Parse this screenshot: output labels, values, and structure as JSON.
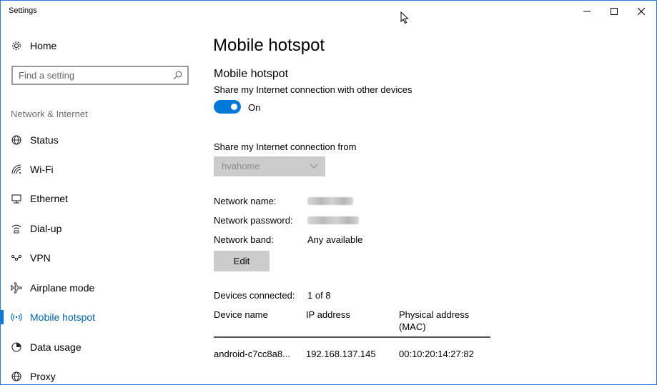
{
  "window": {
    "title": "Settings",
    "controls": {
      "minimize": "—",
      "maximize": "☐",
      "close": "✕"
    }
  },
  "sidebar": {
    "home_label": "Home",
    "search_placeholder": "Find a setting",
    "section_label": "Network & Internet",
    "items": [
      {
        "label": "Status",
        "icon": "globe-status-icon",
        "active": false
      },
      {
        "label": "Wi-Fi",
        "icon": "wifi-icon",
        "active": false
      },
      {
        "label": "Ethernet",
        "icon": "ethernet-icon",
        "active": false
      },
      {
        "label": "Dial-up",
        "icon": "dialup-icon",
        "active": false
      },
      {
        "label": "VPN",
        "icon": "vpn-icon",
        "active": false
      },
      {
        "label": "Airplane mode",
        "icon": "airplane-icon",
        "active": false
      },
      {
        "label": "Mobile hotspot",
        "icon": "hotspot-icon",
        "active": true
      },
      {
        "label": "Data usage",
        "icon": "data-usage-icon",
        "active": false
      },
      {
        "label": "Proxy",
        "icon": "globe-icon",
        "active": false
      }
    ]
  },
  "main": {
    "page_title": "Mobile hotspot",
    "sub_heading": "Mobile hotspot",
    "share_description": "Share my Internet connection with other devices",
    "toggle": {
      "state": "on",
      "label": "On"
    },
    "share_from": {
      "label": "Share my Internet connection from",
      "selected": "hvahome"
    },
    "network_name": {
      "label": "Network name:"
    },
    "network_password": {
      "label": "Network password:"
    },
    "network_band": {
      "label": "Network band:",
      "value": "Any available"
    },
    "edit_label": "Edit",
    "devices": {
      "label": "Devices connected:",
      "count": "1 of 8",
      "headers": [
        "Device name",
        "IP address",
        "Physical address (MAC)"
      ],
      "header_mac_line1": "Physical address",
      "header_mac_line2": "(MAC)",
      "rows": [
        {
          "device_name": "android-c7cc8a8...",
          "ip": "192.168.137.145",
          "mac": "00:10:20:14:27:82"
        }
      ]
    }
  },
  "colors": {
    "accent": "#0078d7",
    "active_text": "#0063b1",
    "window_border": "#2b79d3",
    "muted": "#cccccc"
  }
}
